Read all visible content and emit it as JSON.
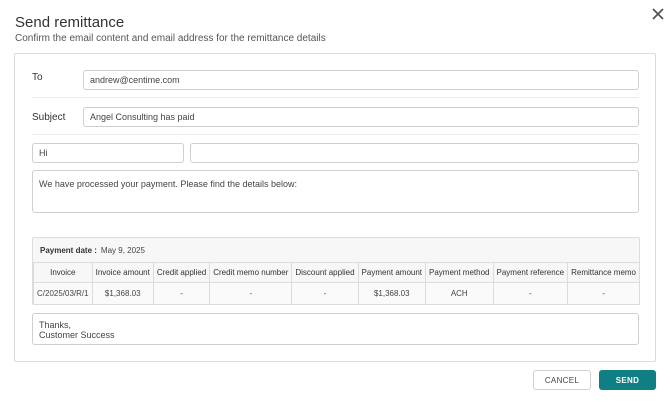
{
  "dialog": {
    "title": "Send remittance",
    "subtitle": "Confirm the email content and email address for the remittance details"
  },
  "form": {
    "to_label": "To",
    "to_value": "andrew@centime.com",
    "subject_label": "Subject",
    "subject_value": "Angel Consulting has paid",
    "greeting_value": "Hi",
    "recipient_name_value": "",
    "body_value": "We have processed your payment. Please find the details below:",
    "closing_line1": "Thanks,",
    "closing_line2": "Customer Success"
  },
  "details": {
    "payment_date_label": "Payment date :",
    "payment_date_value": "May 9, 2025",
    "columns": [
      "Invoice",
      "Invoice amount",
      "Credit applied",
      "Credit memo number",
      "Discount applied",
      "Payment amount",
      "Payment method",
      "Payment reference",
      "Remittance memo"
    ],
    "row": [
      "C/2025/03/R/1",
      "$1,368.03",
      "-",
      "-",
      "-",
      "$1,368.03",
      "ACH",
      "-",
      "-"
    ]
  },
  "actions": {
    "cancel_label": "CANCEL",
    "send_label": "SEND"
  },
  "colors": {
    "primary": "#0f7f84",
    "border": "#dcdcdc"
  },
  "icons": {
    "close": "close-icon"
  }
}
